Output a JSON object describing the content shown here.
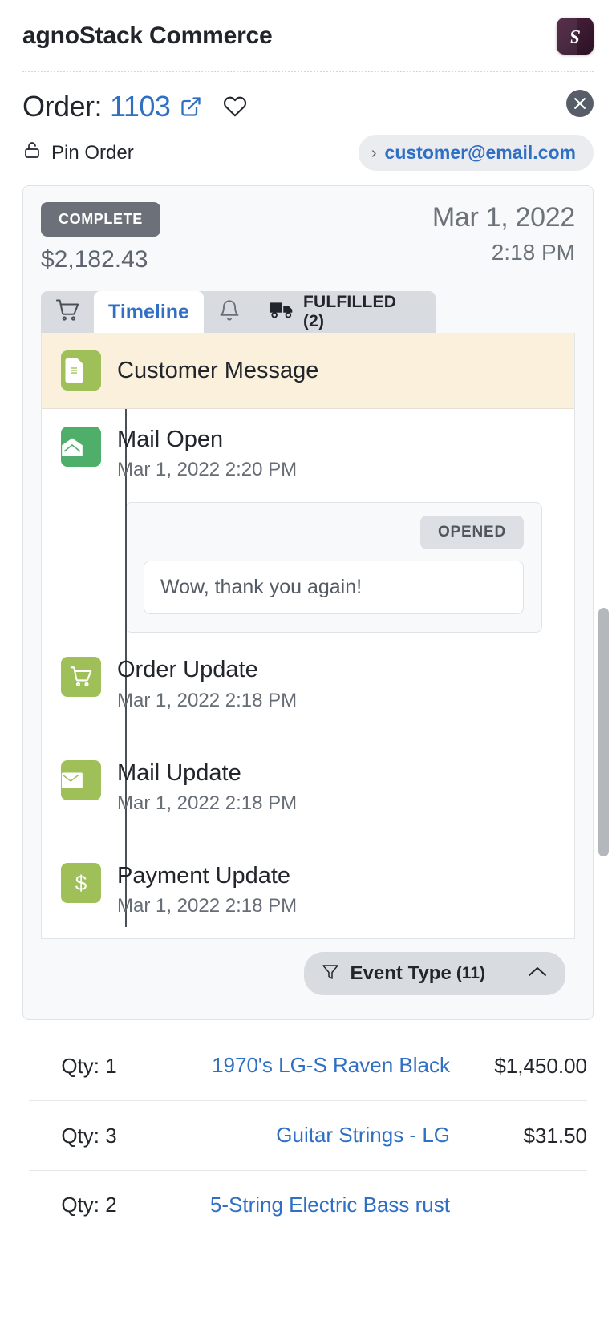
{
  "header": {
    "app_title": "agnoStack Commerce",
    "logo_glyph": "S"
  },
  "order": {
    "label": "Order:",
    "number": "1103",
    "external_link_icon": "external-link-icon",
    "favorite_icon": "heart-icon",
    "close_icon": "close-icon",
    "pin_label": "Pin Order",
    "pin_icon": "lock-open-icon",
    "customer_email": "customer@email.com",
    "email_chevron": "›"
  },
  "summary": {
    "status": "COMPLETE",
    "total": "$2,182.43",
    "date": "Mar 1, 2022",
    "time": "2:18 PM",
    "status_color": "#6b7079"
  },
  "tabs": [
    {
      "id": "cart",
      "icon": "cart-icon",
      "label": "",
      "active": false
    },
    {
      "id": "timeline",
      "icon": "",
      "label": "Timeline",
      "active": true
    },
    {
      "id": "notifications",
      "icon": "bell-icon",
      "label": "",
      "active": false
    },
    {
      "id": "fulfilled",
      "icon": "truck-icon",
      "label": "FULFILLED (2)",
      "active": false
    }
  ],
  "timeline": {
    "banner": {
      "title": "Customer Message",
      "icon": "document-icon",
      "background": "#faf0dc",
      "icon_color": "#9fc059"
    },
    "events": [
      {
        "title": "Mail Open",
        "timestamp": "Mar 1, 2022 2:20 PM",
        "icon": "mail-open-icon",
        "icon_color": "#4eae6a",
        "detail": {
          "status_chip": "OPENED",
          "message": "Wow, thank you again!"
        }
      },
      {
        "title": "Order Update",
        "timestamp": "Mar 1, 2022 2:18 PM",
        "icon": "cart-icon",
        "icon_color": "#9fc059"
      },
      {
        "title": "Mail Update",
        "timestamp": "Mar 1, 2022 2:18 PM",
        "icon": "mail-icon",
        "icon_color": "#9fc059"
      },
      {
        "title": "Payment Update",
        "timestamp": "Mar 1, 2022 2:18 PM",
        "icon": "dollar-icon",
        "icon_color": "#9fc059"
      }
    ]
  },
  "filter": {
    "icon": "filter-icon",
    "label": "Event Type",
    "count": "(11)",
    "chevron": "chevron-up-icon"
  },
  "line_items": [
    {
      "qty": "Qty: 1",
      "name": "1970's LG-S Raven Black",
      "price": "$1,450.00"
    },
    {
      "qty": "Qty: 3",
      "name": "Guitar Strings - LG",
      "price": "$31.50"
    },
    {
      "qty": "Qty: 2",
      "name": "5-String Electric Bass rust",
      "price": ""
    }
  ]
}
